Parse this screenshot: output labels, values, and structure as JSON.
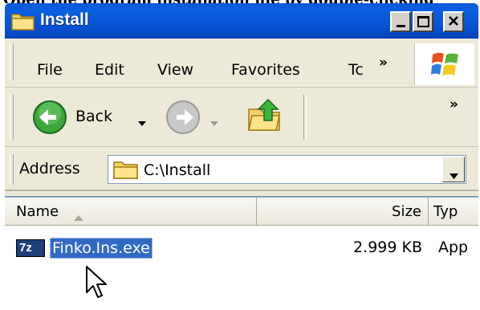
{
  "caption_partial": "Open the program installation file by double-clicking",
  "window": {
    "title": "Install",
    "controls": {
      "minimize_icon": "minimize-icon",
      "maximize_icon": "maximize-icon",
      "close_icon": "close-icon"
    }
  },
  "menu": {
    "items": [
      {
        "label": "File"
      },
      {
        "label": "Edit"
      },
      {
        "label": "View"
      },
      {
        "label": "Favorites"
      },
      {
        "label": "Tc"
      }
    ],
    "overflow": "»"
  },
  "toolbar": {
    "back_label": "Back",
    "overflow": "»",
    "icons": {
      "back": "back-arrow-icon",
      "forward": "forward-arrow-icon",
      "up": "up-folder-icon"
    }
  },
  "address": {
    "label": "Address",
    "value": "C:\\Install"
  },
  "list": {
    "columns": [
      {
        "label": "Name"
      },
      {
        "label": "Size"
      },
      {
        "label": "Typ"
      }
    ],
    "rows": [
      {
        "name": "Finko.Ins.exe",
        "size": "2.999 KB",
        "type": "App",
        "icon": "7z",
        "selected": true
      }
    ]
  },
  "colors": {
    "titlebar": "#0a58d6",
    "selection": "#316ac5",
    "chrome": "#ece9d8"
  }
}
